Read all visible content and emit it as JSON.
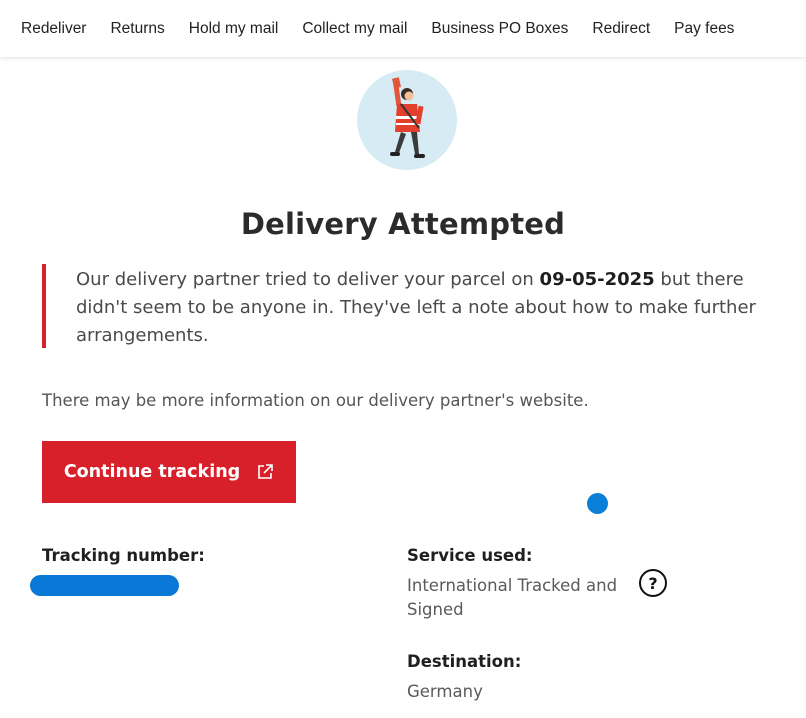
{
  "nav": {
    "items": [
      "Redeliver",
      "Returns",
      "Hold my mail",
      "Collect my mail",
      "Business PO Boxes",
      "Redirect",
      "Pay fees"
    ]
  },
  "status": {
    "title": "Delivery Attempted",
    "message_before": "Our delivery partner tried to deliver your parcel on ",
    "date": "09-05-2025",
    "message_after": " but there didn't seem to be anyone in. They've left a note about how to make further arrangements."
  },
  "more_info": "There may be more information on our delivery partner's website.",
  "cta": {
    "label": "Continue tracking",
    "icon": "external-link-icon"
  },
  "details": {
    "tracking_label": "Tracking number:",
    "service_label": "Service used:",
    "service_value": "International Tracked and Signed",
    "destination_label": "Destination:",
    "destination_value": "Germany",
    "help_glyph": "?"
  },
  "colors": {
    "accent": "#d8202a",
    "redaction": "#0a78d6",
    "hero_bg": "#d6ebf4"
  }
}
